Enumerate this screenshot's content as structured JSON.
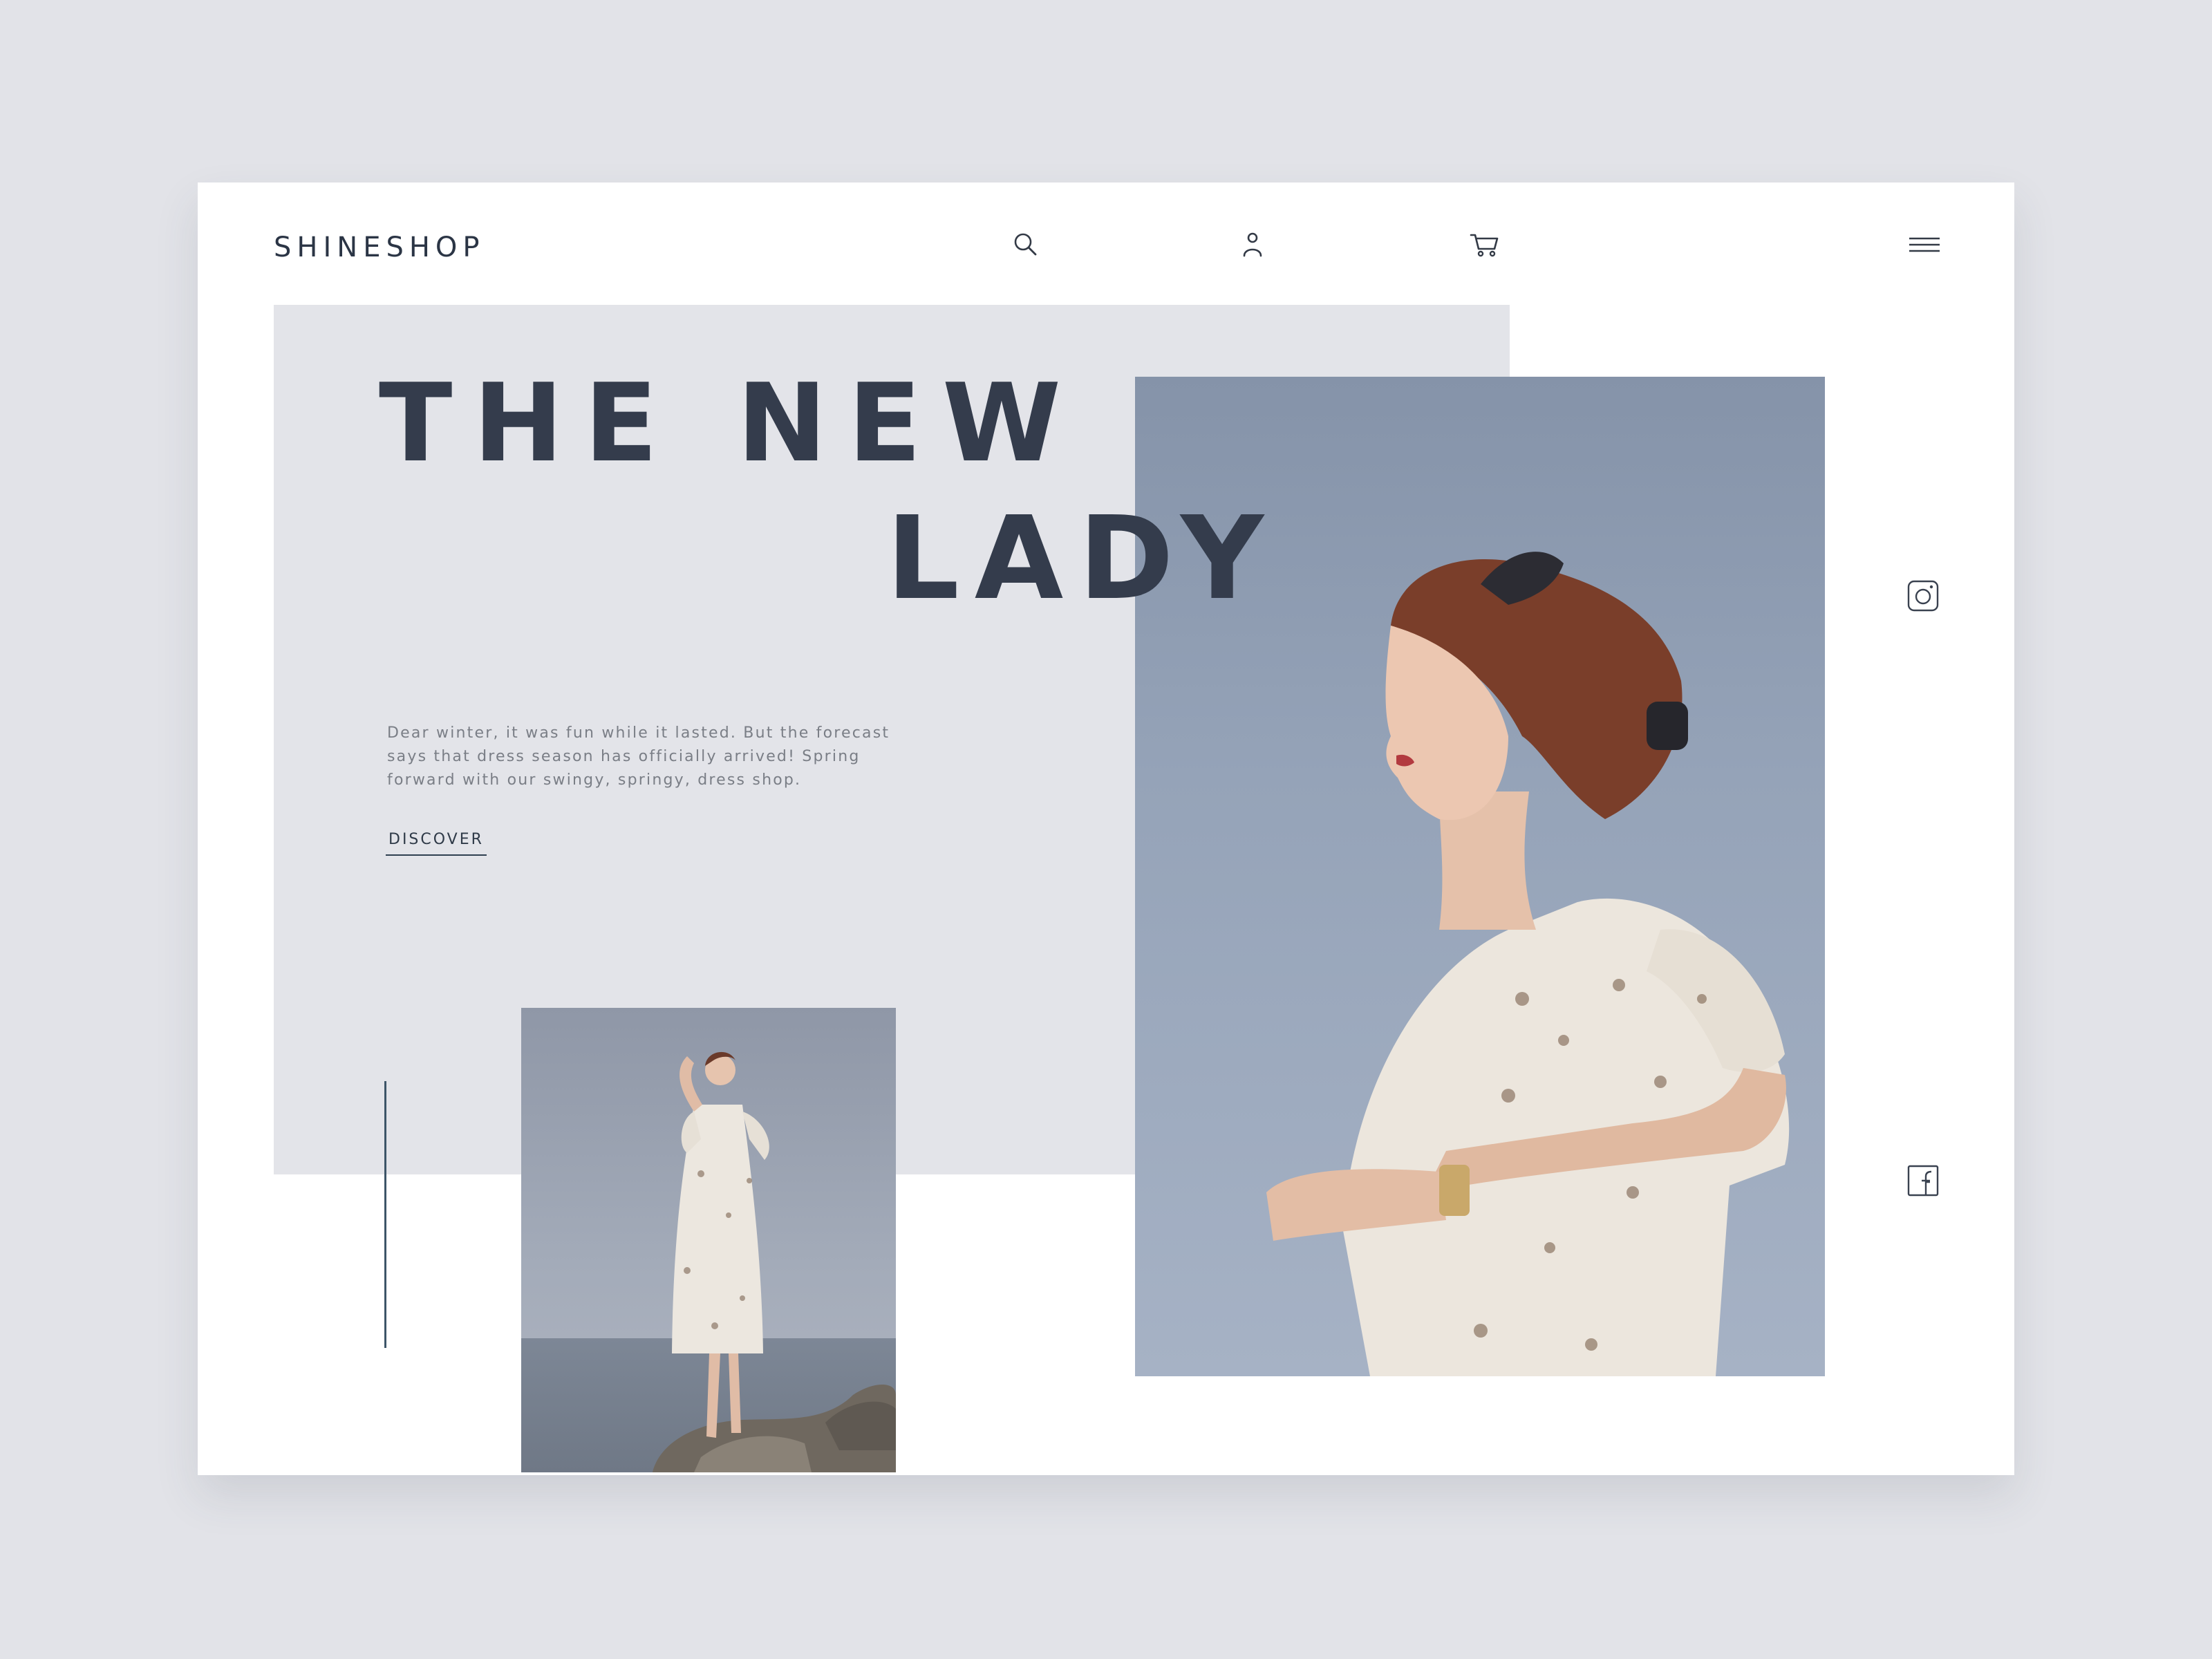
{
  "brand": {
    "name": "SHINESHOP"
  },
  "header": {
    "icons": [
      "search-icon",
      "user-icon",
      "cart-icon",
      "menu-icon"
    ]
  },
  "hero": {
    "headline_line1": "THE NEW",
    "headline_line2": "LADY",
    "description": "Dear winter, it was fun while it lasted. But the forecast says that dress season has officially arrived! Spring forward with our swingy, springy, dress shop.",
    "cta_label": "DISCOVER"
  },
  "social": {
    "icons": [
      "instagram-icon",
      "facebook-icon"
    ]
  },
  "colors": {
    "background": "#e2e3e8",
    "card": "#ffffff",
    "panel": "#e3e4e9",
    "headline": "#343c4c",
    "accent_line": "#3d5568"
  }
}
